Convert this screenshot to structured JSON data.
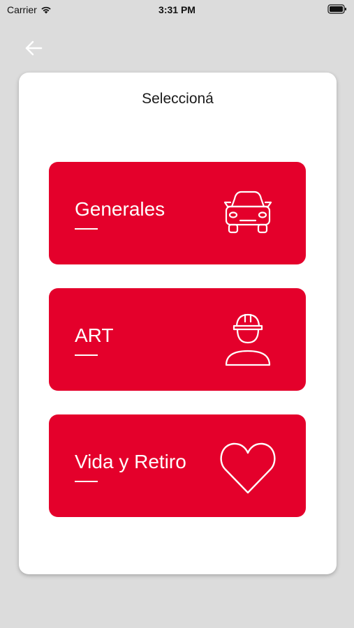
{
  "status_bar": {
    "carrier": "Carrier",
    "time": "3:31 PM"
  },
  "header": {
    "back_icon": "arrow-left-icon"
  },
  "card": {
    "title": "Seleccioná",
    "options": [
      {
        "label": "Generales",
        "icon": "car-icon"
      },
      {
        "label": "ART",
        "icon": "worker-helmet-icon"
      },
      {
        "label": "Vida y Retiro",
        "icon": "heart-icon"
      }
    ]
  },
  "colors": {
    "accent": "#e4002b",
    "background": "#dcdcdc",
    "card": "#ffffff"
  }
}
